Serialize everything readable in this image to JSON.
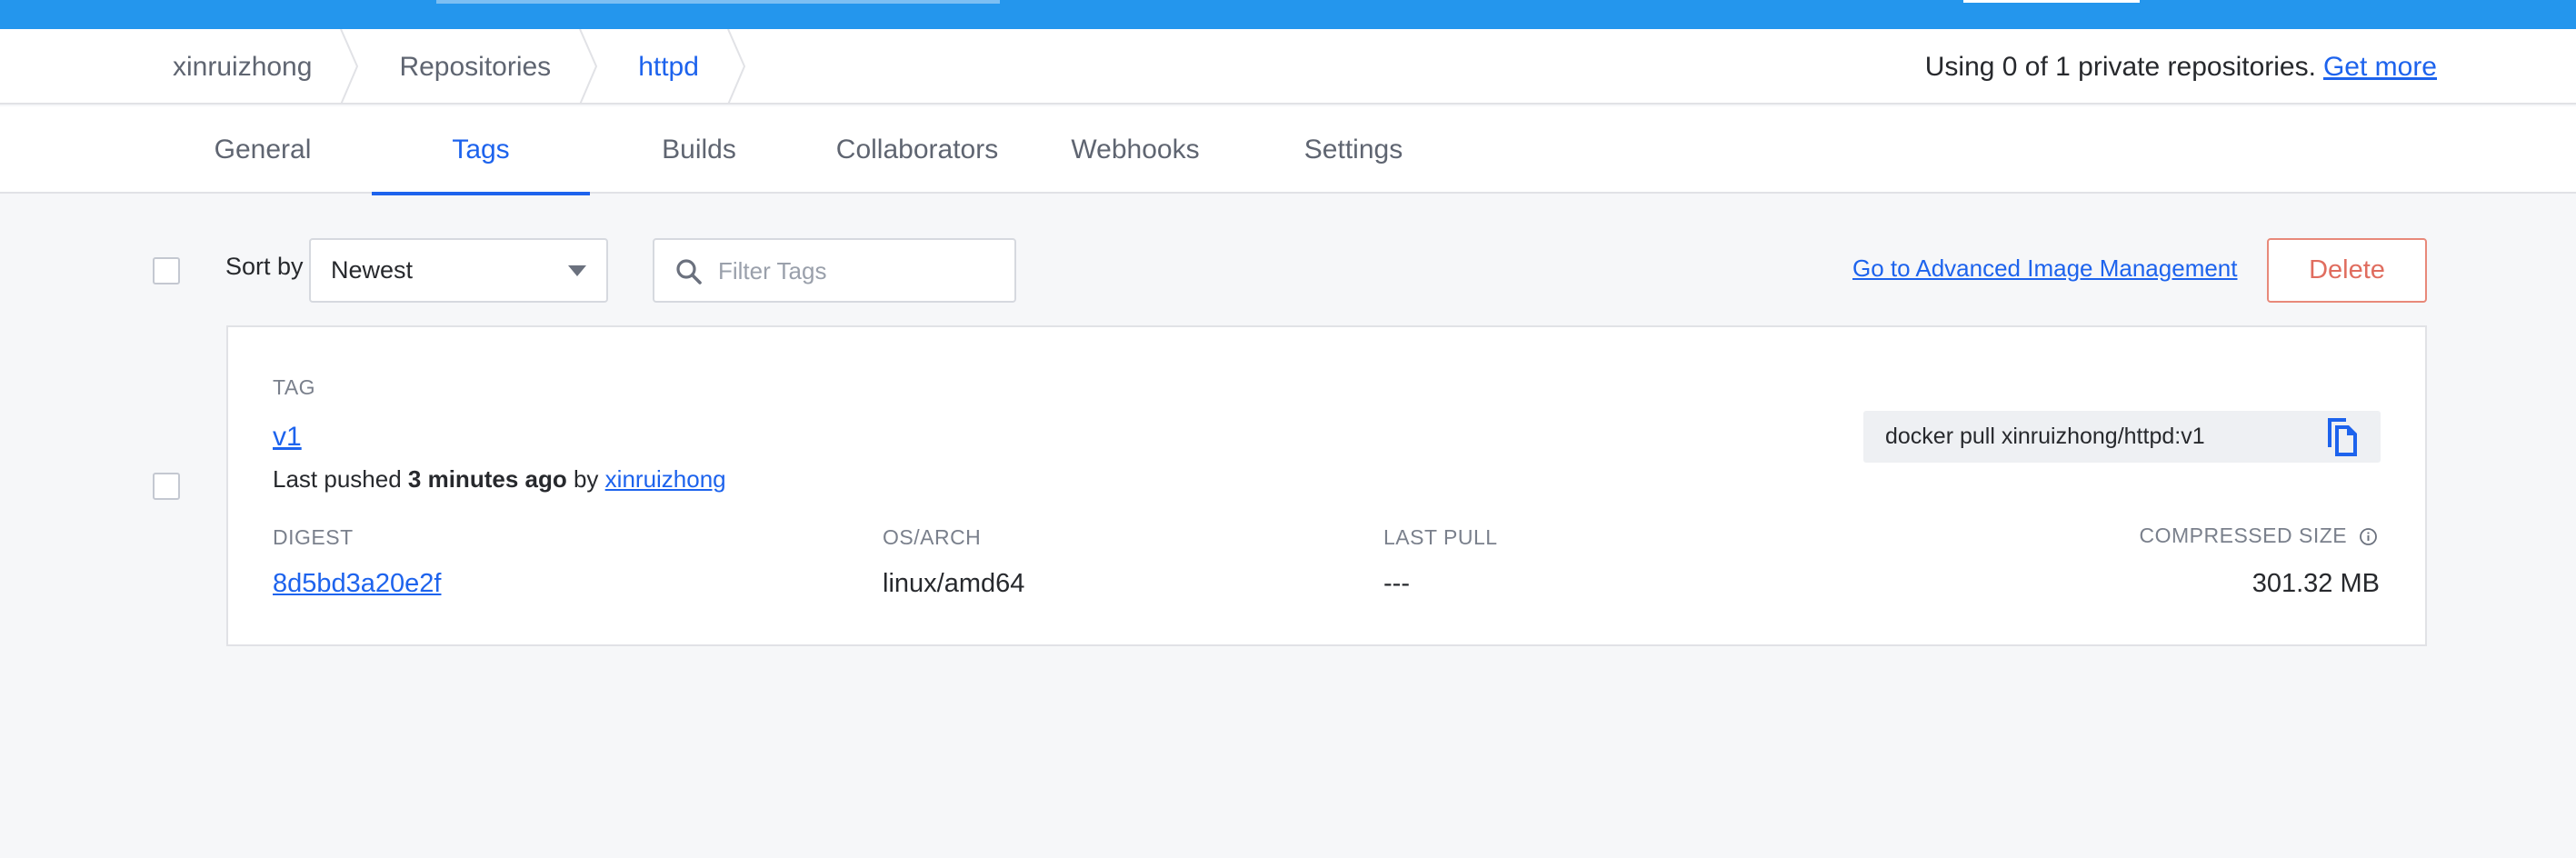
{
  "breadcrumb": {
    "items": [
      {
        "label": "xinruizhong"
      },
      {
        "label": "Repositories"
      },
      {
        "label": "httpd"
      }
    ]
  },
  "usage": {
    "text": "Using 0 of 1 private repositories.",
    "link": "Get more"
  },
  "tabs": [
    {
      "label": "General"
    },
    {
      "label": "Tags"
    },
    {
      "label": "Builds"
    },
    {
      "label": "Collaborators"
    },
    {
      "label": "Webhooks"
    },
    {
      "label": "Settings"
    }
  ],
  "active_tab": "Tags",
  "toolbar": {
    "sort_label": "Sort by",
    "sort_value": "Newest",
    "filter_placeholder": "Filter Tags",
    "advanced_link": "Go to Advanced Image Management",
    "delete_label": "Delete"
  },
  "tag": {
    "header": "TAG",
    "name": "v1",
    "pushed_prefix": "Last pushed",
    "pushed_time": "3 minutes ago",
    "pushed_by_word": "by",
    "pushed_by": "xinruizhong",
    "pull_command": "docker pull xinruizhong/httpd:v1",
    "columns": {
      "digest": "DIGEST",
      "os_arch": "OS/ARCH",
      "last_pull": "LAST PULL",
      "size": "COMPRESSED SIZE"
    },
    "values": {
      "digest": "8d5bd3a20e2f",
      "os_arch": "linux/amd64",
      "last_pull": "---",
      "size": "301.32 MB"
    }
  },
  "icons": {
    "search": "search-icon",
    "copy": "copy-icon",
    "info": "info-icon",
    "caret": "chevron-down-icon"
  },
  "colors": {
    "brand_blue": "#2496ed",
    "link_blue": "#1d63ed",
    "delete_red": "#e06d5f"
  }
}
